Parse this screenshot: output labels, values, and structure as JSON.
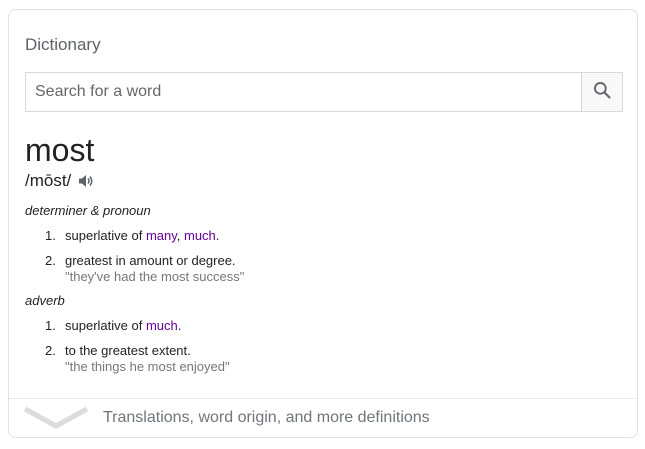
{
  "card": {
    "title": "Dictionary"
  },
  "search": {
    "placeholder": "Search for a word",
    "icon": "search-icon"
  },
  "entry": {
    "word": "most",
    "pronunciation": "/mōst/",
    "audio_icon": "speaker-icon",
    "senses": [
      {
        "part_of_speech": "determiner & pronoun",
        "definitions": [
          {
            "number": "1.",
            "prefix": "superlative of ",
            "links": [
              "many",
              "much"
            ],
            "separator": ", ",
            "suffix": "."
          },
          {
            "number": "2.",
            "text": "greatest in amount or degree.",
            "example": "\"they've had the most success\""
          }
        ]
      },
      {
        "part_of_speech": "adverb",
        "definitions": [
          {
            "number": "1.",
            "prefix": "superlative of ",
            "links": [
              "much"
            ],
            "suffix": "."
          },
          {
            "number": "2.",
            "text": "to the greatest extent.",
            "example": "\"the things he most enjoyed\""
          }
        ]
      }
    ]
  },
  "footer": {
    "text": "Translations, word origin, and more definitions",
    "icon": "chevron-down-icon"
  },
  "colors": {
    "link": "#660099",
    "muted": "#777777",
    "border": "#dfe1e5"
  }
}
